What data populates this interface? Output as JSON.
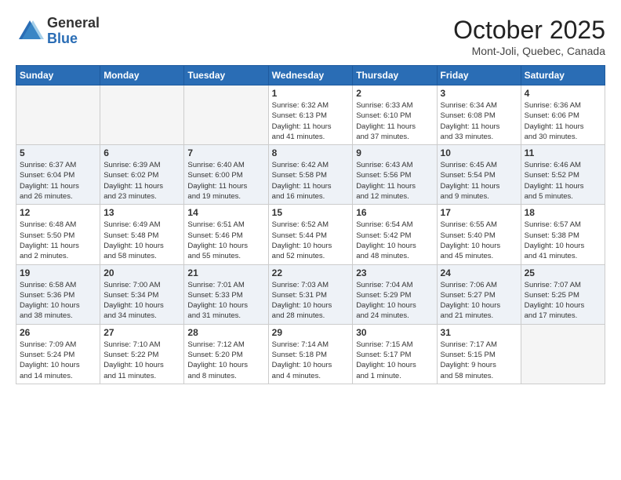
{
  "header": {
    "logo_general": "General",
    "logo_blue": "Blue",
    "month_title": "October 2025",
    "location": "Mont-Joli, Quebec, Canada"
  },
  "weekdays": [
    "Sunday",
    "Monday",
    "Tuesday",
    "Wednesday",
    "Thursday",
    "Friday",
    "Saturday"
  ],
  "weeks": [
    [
      {
        "day": "",
        "info": ""
      },
      {
        "day": "",
        "info": ""
      },
      {
        "day": "",
        "info": ""
      },
      {
        "day": "1",
        "info": "Sunrise: 6:32 AM\nSunset: 6:13 PM\nDaylight: 11 hours\nand 41 minutes."
      },
      {
        "day": "2",
        "info": "Sunrise: 6:33 AM\nSunset: 6:10 PM\nDaylight: 11 hours\nand 37 minutes."
      },
      {
        "day": "3",
        "info": "Sunrise: 6:34 AM\nSunset: 6:08 PM\nDaylight: 11 hours\nand 33 minutes."
      },
      {
        "day": "4",
        "info": "Sunrise: 6:36 AM\nSunset: 6:06 PM\nDaylight: 11 hours\nand 30 minutes."
      }
    ],
    [
      {
        "day": "5",
        "info": "Sunrise: 6:37 AM\nSunset: 6:04 PM\nDaylight: 11 hours\nand 26 minutes."
      },
      {
        "day": "6",
        "info": "Sunrise: 6:39 AM\nSunset: 6:02 PM\nDaylight: 11 hours\nand 23 minutes."
      },
      {
        "day": "7",
        "info": "Sunrise: 6:40 AM\nSunset: 6:00 PM\nDaylight: 11 hours\nand 19 minutes."
      },
      {
        "day": "8",
        "info": "Sunrise: 6:42 AM\nSunset: 5:58 PM\nDaylight: 11 hours\nand 16 minutes."
      },
      {
        "day": "9",
        "info": "Sunrise: 6:43 AM\nSunset: 5:56 PM\nDaylight: 11 hours\nand 12 minutes."
      },
      {
        "day": "10",
        "info": "Sunrise: 6:45 AM\nSunset: 5:54 PM\nDaylight: 11 hours\nand 9 minutes."
      },
      {
        "day": "11",
        "info": "Sunrise: 6:46 AM\nSunset: 5:52 PM\nDaylight: 11 hours\nand 5 minutes."
      }
    ],
    [
      {
        "day": "12",
        "info": "Sunrise: 6:48 AM\nSunset: 5:50 PM\nDaylight: 11 hours\nand 2 minutes."
      },
      {
        "day": "13",
        "info": "Sunrise: 6:49 AM\nSunset: 5:48 PM\nDaylight: 10 hours\nand 58 minutes."
      },
      {
        "day": "14",
        "info": "Sunrise: 6:51 AM\nSunset: 5:46 PM\nDaylight: 10 hours\nand 55 minutes."
      },
      {
        "day": "15",
        "info": "Sunrise: 6:52 AM\nSunset: 5:44 PM\nDaylight: 10 hours\nand 52 minutes."
      },
      {
        "day": "16",
        "info": "Sunrise: 6:54 AM\nSunset: 5:42 PM\nDaylight: 10 hours\nand 48 minutes."
      },
      {
        "day": "17",
        "info": "Sunrise: 6:55 AM\nSunset: 5:40 PM\nDaylight: 10 hours\nand 45 minutes."
      },
      {
        "day": "18",
        "info": "Sunrise: 6:57 AM\nSunset: 5:38 PM\nDaylight: 10 hours\nand 41 minutes."
      }
    ],
    [
      {
        "day": "19",
        "info": "Sunrise: 6:58 AM\nSunset: 5:36 PM\nDaylight: 10 hours\nand 38 minutes."
      },
      {
        "day": "20",
        "info": "Sunrise: 7:00 AM\nSunset: 5:34 PM\nDaylight: 10 hours\nand 34 minutes."
      },
      {
        "day": "21",
        "info": "Sunrise: 7:01 AM\nSunset: 5:33 PM\nDaylight: 10 hours\nand 31 minutes."
      },
      {
        "day": "22",
        "info": "Sunrise: 7:03 AM\nSunset: 5:31 PM\nDaylight: 10 hours\nand 28 minutes."
      },
      {
        "day": "23",
        "info": "Sunrise: 7:04 AM\nSunset: 5:29 PM\nDaylight: 10 hours\nand 24 minutes."
      },
      {
        "day": "24",
        "info": "Sunrise: 7:06 AM\nSunset: 5:27 PM\nDaylight: 10 hours\nand 21 minutes."
      },
      {
        "day": "25",
        "info": "Sunrise: 7:07 AM\nSunset: 5:25 PM\nDaylight: 10 hours\nand 17 minutes."
      }
    ],
    [
      {
        "day": "26",
        "info": "Sunrise: 7:09 AM\nSunset: 5:24 PM\nDaylight: 10 hours\nand 14 minutes."
      },
      {
        "day": "27",
        "info": "Sunrise: 7:10 AM\nSunset: 5:22 PM\nDaylight: 10 hours\nand 11 minutes."
      },
      {
        "day": "28",
        "info": "Sunrise: 7:12 AM\nSunset: 5:20 PM\nDaylight: 10 hours\nand 8 minutes."
      },
      {
        "day": "29",
        "info": "Sunrise: 7:14 AM\nSunset: 5:18 PM\nDaylight: 10 hours\nand 4 minutes."
      },
      {
        "day": "30",
        "info": "Sunrise: 7:15 AM\nSunset: 5:17 PM\nDaylight: 10 hours\nand 1 minute."
      },
      {
        "day": "31",
        "info": "Sunrise: 7:17 AM\nSunset: 5:15 PM\nDaylight: 9 hours\nand 58 minutes."
      },
      {
        "day": "",
        "info": ""
      }
    ]
  ]
}
